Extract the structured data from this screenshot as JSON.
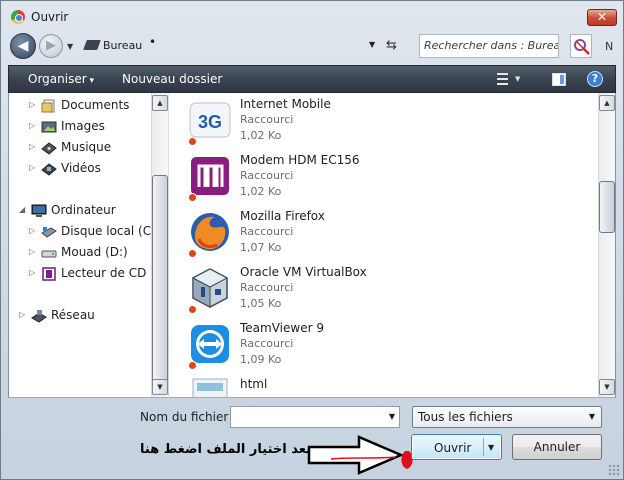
{
  "window": {
    "title": "Ouvrir",
    "close_label": "✕"
  },
  "address": {
    "location": "Bureau",
    "separator": "•",
    "search_placeholder": "Rechercher dans : Bureau",
    "search_overflow": "N"
  },
  "toolbar": {
    "organise_label": "Organiser",
    "new_folder_label": "Nouveau dossier",
    "help_label": "?"
  },
  "navigation": {
    "items": [
      {
        "label": "Documents",
        "icon": "documents-icon"
      },
      {
        "label": "Images",
        "icon": "images-icon"
      },
      {
        "label": "Musique",
        "icon": "music-icon"
      },
      {
        "label": "Vidéos",
        "icon": "videos-icon"
      },
      {
        "label": "Ordinateur",
        "icon": "computer-icon"
      },
      {
        "label": "Disque local (C:)",
        "icon": "local-disk-icon"
      },
      {
        "label": "Mouad (D:)",
        "icon": "disk-icon"
      },
      {
        "label": "Lecteur de CD (E:",
        "icon": "cd-drive-icon"
      },
      {
        "label": "Réseau",
        "icon": "network-icon"
      }
    ]
  },
  "files": [
    {
      "name": "Internet Mobile",
      "type": "Raccourci",
      "size": "1,02 Ko",
      "icon": "3g-icon",
      "badge": "3G"
    },
    {
      "name": "Modem HDM EC156",
      "type": "Raccourci",
      "size": "1,02 Ko",
      "icon": "modem-icon"
    },
    {
      "name": "Mozilla Firefox",
      "type": "Raccourci",
      "size": "1,07 Ko",
      "icon": "firefox-icon"
    },
    {
      "name": "Oracle VM VirtualBox",
      "type": "Raccourci",
      "size": "1,05 Ko",
      "icon": "virtualbox-icon"
    },
    {
      "name": "TeamViewer 9",
      "type": "Raccourci",
      "size": "1,09 Ko",
      "icon": "teamviewer-icon"
    },
    {
      "name": "html",
      "type": "",
      "size": "",
      "icon": "html-icon"
    }
  ],
  "bottom": {
    "filename_label": "Nom du fichier :",
    "filename_value": "",
    "filetype_value": "Tous les fichiers",
    "open_label": "Ouvrir",
    "cancel_label": "Annuler"
  },
  "annotation": {
    "text": "بعد اختيار الملف اضغط هنا"
  },
  "colors": {
    "command_bar": "#3a4450",
    "open_button": "#d9f0fc",
    "annotation_arrow": "#e0101a"
  }
}
